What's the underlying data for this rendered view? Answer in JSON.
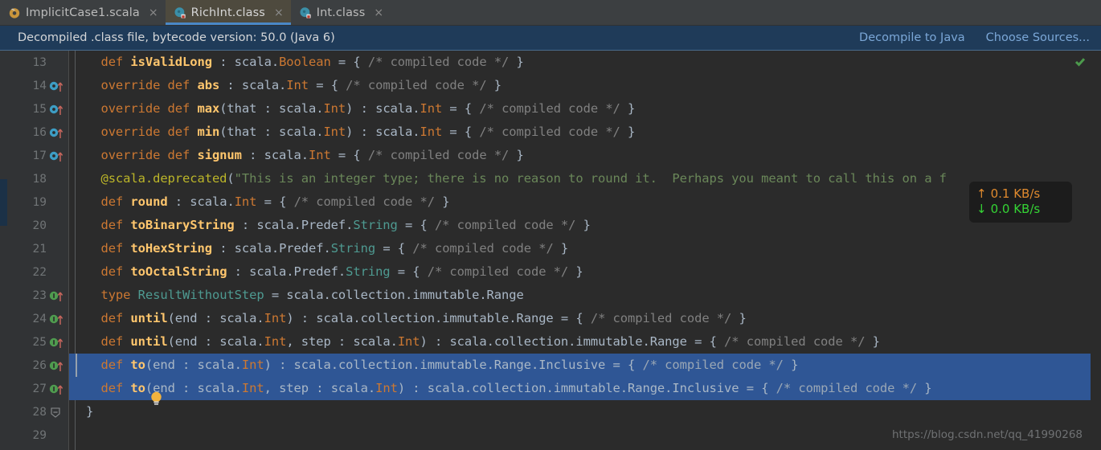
{
  "tabs": [
    {
      "label": "ImplicitCase1.scala",
      "icon": "scala-file-icon",
      "active": false,
      "close": "×"
    },
    {
      "label": "RichInt.class",
      "icon": "class-file-icon",
      "active": true,
      "close": "×"
    },
    {
      "label": "Int.class",
      "icon": "class-file-icon",
      "active": false,
      "close": "×"
    }
  ],
  "banner": {
    "message": "Decompiled .class file, bytecode version: 50.0 (Java 6)",
    "decompile_label": "Decompile to Java",
    "choose_sources_label": "Choose Sources...",
    "background": "#1f3b59",
    "link_color": "#7ba7d7"
  },
  "network_widget": {
    "up_arrow": "↑",
    "up_value": "0.1 KB/s",
    "up_color": "#e08a2e",
    "down_arrow": "↓",
    "down_value": "0.0 KB/s",
    "down_color": "#35d435"
  },
  "watermark": "https://blog.csdn.net/qq_41990268",
  "editor": {
    "first_visible_line": 13,
    "selected_lines": [
      26,
      27
    ],
    "selection_color": "#2f5695",
    "background": "#2b2b2b",
    "gutter_background": "#313335",
    "lines": [
      {
        "number": 13,
        "marker": "none",
        "text": "def isValidLong : scala.Boolean = { /* compiled code */ }",
        "tokens": [
          {
            "t": "  ",
            "c": "pn"
          },
          {
            "t": "def ",
            "c": "k"
          },
          {
            "t": "isValidLong",
            "c": "mn"
          },
          {
            "t": " : ",
            "c": "pn"
          },
          {
            "t": "scala.",
            "c": "pk"
          },
          {
            "t": "Boolean",
            "c": "ty"
          },
          {
            "t": " = { ",
            "c": "pn"
          },
          {
            "t": "/* compiled code */",
            "c": "cm"
          },
          {
            "t": " }",
            "c": "pn"
          }
        ]
      },
      {
        "number": 14,
        "marker": "override",
        "text": "override def abs : scala.Int = { /* compiled code */ }",
        "tokens": [
          {
            "t": "  ",
            "c": "pn"
          },
          {
            "t": "override def ",
            "c": "k"
          },
          {
            "t": "abs",
            "c": "mn"
          },
          {
            "t": " : ",
            "c": "pn"
          },
          {
            "t": "scala.",
            "c": "pk"
          },
          {
            "t": "Int",
            "c": "ty"
          },
          {
            "t": " = { ",
            "c": "pn"
          },
          {
            "t": "/* compiled code */",
            "c": "cm"
          },
          {
            "t": " }",
            "c": "pn"
          }
        ]
      },
      {
        "number": 15,
        "marker": "override",
        "text": "override def max(that : scala.Int) : scala.Int = { /* compiled code */ }",
        "tokens": [
          {
            "t": "  ",
            "c": "pn"
          },
          {
            "t": "override def ",
            "c": "k"
          },
          {
            "t": "max",
            "c": "mn"
          },
          {
            "t": "(that : ",
            "c": "pn"
          },
          {
            "t": "scala.",
            "c": "pk"
          },
          {
            "t": "Int",
            "c": "ty"
          },
          {
            "t": ") : ",
            "c": "pn"
          },
          {
            "t": "scala.",
            "c": "pk"
          },
          {
            "t": "Int",
            "c": "ty"
          },
          {
            "t": " = { ",
            "c": "pn"
          },
          {
            "t": "/* compiled code */",
            "c": "cm"
          },
          {
            "t": " }",
            "c": "pn"
          }
        ]
      },
      {
        "number": 16,
        "marker": "override",
        "text": "override def min(that : scala.Int) : scala.Int = { /* compiled code */ }",
        "tokens": [
          {
            "t": "  ",
            "c": "pn"
          },
          {
            "t": "override def ",
            "c": "k"
          },
          {
            "t": "min",
            "c": "mn"
          },
          {
            "t": "(that : ",
            "c": "pn"
          },
          {
            "t": "scala.",
            "c": "pk"
          },
          {
            "t": "Int",
            "c": "ty"
          },
          {
            "t": ") : ",
            "c": "pn"
          },
          {
            "t": "scala.",
            "c": "pk"
          },
          {
            "t": "Int",
            "c": "ty"
          },
          {
            "t": " = { ",
            "c": "pn"
          },
          {
            "t": "/* compiled code */",
            "c": "cm"
          },
          {
            "t": " }",
            "c": "pn"
          }
        ]
      },
      {
        "number": 17,
        "marker": "override",
        "text": "override def signum : scala.Int = { /* compiled code */ }",
        "tokens": [
          {
            "t": "  ",
            "c": "pn"
          },
          {
            "t": "override def ",
            "c": "k"
          },
          {
            "t": "signum",
            "c": "mn"
          },
          {
            "t": " : ",
            "c": "pn"
          },
          {
            "t": "scala.",
            "c": "pk"
          },
          {
            "t": "Int",
            "c": "ty"
          },
          {
            "t": " = { ",
            "c": "pn"
          },
          {
            "t": "/* compiled code */",
            "c": "cm"
          },
          {
            "t": " }",
            "c": "pn"
          }
        ]
      },
      {
        "number": 18,
        "marker": "none",
        "text": "@scala.deprecated(\"This is an integer type; there is no reason to round it.  Perhaps you meant to call this on a f",
        "tokens": [
          {
            "t": "  ",
            "c": "pn"
          },
          {
            "t": "@scala.deprecated",
            "c": "an"
          },
          {
            "t": "(",
            "c": "pn"
          },
          {
            "t": "\"This is an integer type; there is no reason to round it.  Perhaps you meant to call this on a f",
            "c": "st"
          }
        ]
      },
      {
        "number": 19,
        "marker": "none",
        "text": "def round : scala.Int = { /* compiled code */ }",
        "tokens": [
          {
            "t": "  ",
            "c": "pn"
          },
          {
            "t": "def ",
            "c": "k"
          },
          {
            "t": "round",
            "c": "mn"
          },
          {
            "t": " : ",
            "c": "pn"
          },
          {
            "t": "scala.",
            "c": "pk"
          },
          {
            "t": "Int",
            "c": "ty"
          },
          {
            "t": " = { ",
            "c": "pn"
          },
          {
            "t": "/* compiled code */",
            "c": "cm"
          },
          {
            "t": " }",
            "c": "pn"
          }
        ]
      },
      {
        "number": 20,
        "marker": "none",
        "text": "def toBinaryString : scala.Predef.String = { /* compiled code */ }",
        "tokens": [
          {
            "t": "  ",
            "c": "pn"
          },
          {
            "t": "def ",
            "c": "k"
          },
          {
            "t": "toBinaryString",
            "c": "mn"
          },
          {
            "t": " : ",
            "c": "pn"
          },
          {
            "t": "scala.Predef.",
            "c": "pk"
          },
          {
            "t": "String",
            "c": "ty2"
          },
          {
            "t": " = { ",
            "c": "pn"
          },
          {
            "t": "/* compiled code */",
            "c": "cm"
          },
          {
            "t": " }",
            "c": "pn"
          }
        ]
      },
      {
        "number": 21,
        "marker": "none",
        "text": "def toHexString : scala.Predef.String = { /* compiled code */ }",
        "tokens": [
          {
            "t": "  ",
            "c": "pn"
          },
          {
            "t": "def ",
            "c": "k"
          },
          {
            "t": "toHexString",
            "c": "mn"
          },
          {
            "t": " : ",
            "c": "pn"
          },
          {
            "t": "scala.Predef.",
            "c": "pk"
          },
          {
            "t": "String",
            "c": "ty2"
          },
          {
            "t": " = { ",
            "c": "pn"
          },
          {
            "t": "/* compiled code */",
            "c": "cm"
          },
          {
            "t": " }",
            "c": "pn"
          }
        ]
      },
      {
        "number": 22,
        "marker": "none",
        "text": "def toOctalString : scala.Predef.String = { /* compiled code */ }",
        "tokens": [
          {
            "t": "  ",
            "c": "pn"
          },
          {
            "t": "def ",
            "c": "k"
          },
          {
            "t": "toOctalString",
            "c": "mn"
          },
          {
            "t": " : ",
            "c": "pn"
          },
          {
            "t": "scala.Predef.",
            "c": "pk"
          },
          {
            "t": "String",
            "c": "ty2"
          },
          {
            "t": " = { ",
            "c": "pn"
          },
          {
            "t": "/* compiled code */",
            "c": "cm"
          },
          {
            "t": " }",
            "c": "pn"
          }
        ]
      },
      {
        "number": 23,
        "marker": "implement",
        "text": "type ResultWithoutStep = scala.collection.immutable.Range",
        "tokens": [
          {
            "t": "  ",
            "c": "pn"
          },
          {
            "t": "type ",
            "c": "k"
          },
          {
            "t": "ResultWithoutStep",
            "c": "ty2"
          },
          {
            "t": " = ",
            "c": "pn"
          },
          {
            "t": "scala.collection.immutable.Range",
            "c": "pk"
          }
        ]
      },
      {
        "number": 24,
        "marker": "implement",
        "text": "def until(end : scala.Int) : scala.collection.immutable.Range = { /* compiled code */ }",
        "tokens": [
          {
            "t": "  ",
            "c": "pn"
          },
          {
            "t": "def ",
            "c": "k"
          },
          {
            "t": "until",
            "c": "mn"
          },
          {
            "t": "(end : ",
            "c": "pn"
          },
          {
            "t": "scala.",
            "c": "pk"
          },
          {
            "t": "Int",
            "c": "ty"
          },
          {
            "t": ") : ",
            "c": "pn"
          },
          {
            "t": "scala.collection.immutable.Range",
            "c": "pk"
          },
          {
            "t": " = { ",
            "c": "pn"
          },
          {
            "t": "/* compiled code */",
            "c": "cm"
          },
          {
            "t": " }",
            "c": "pn"
          }
        ]
      },
      {
        "number": 25,
        "marker": "implement",
        "text": "def until(end : scala.Int, step : scala.Int) : scala.collection.immutable.Range = { /* compiled code */ }",
        "tokens": [
          {
            "t": "  ",
            "c": "pn"
          },
          {
            "t": "def ",
            "c": "k"
          },
          {
            "t": "until",
            "c": "mn"
          },
          {
            "t": "(end : ",
            "c": "pn"
          },
          {
            "t": "scala.",
            "c": "pk"
          },
          {
            "t": "Int",
            "c": "ty"
          },
          {
            "t": ", step : ",
            "c": "pn"
          },
          {
            "t": "scala.",
            "c": "pk"
          },
          {
            "t": "Int",
            "c": "ty"
          },
          {
            "t": ") : ",
            "c": "pn"
          },
          {
            "t": "scala.collection.immutable.Range",
            "c": "pk"
          },
          {
            "t": " = { ",
            "c": "pn"
          },
          {
            "t": "/* compiled code */",
            "c": "cm"
          },
          {
            "t": " }",
            "c": "pn"
          }
        ]
      },
      {
        "number": 26,
        "marker": "implement",
        "text": "def to(end : scala.Int) : scala.collection.immutable.Range.Inclusive = { /* compiled code */ }",
        "tokens": [
          {
            "t": "  ",
            "c": "pn"
          },
          {
            "t": "def ",
            "c": "k"
          },
          {
            "t": "to",
            "c": "mn"
          },
          {
            "t": "(end : ",
            "c": "pn"
          },
          {
            "t": "scala.",
            "c": "pk"
          },
          {
            "t": "Int",
            "c": "ty"
          },
          {
            "t": ") : ",
            "c": "pn"
          },
          {
            "t": "scala.collection.immutable.Range.Inclusive",
            "c": "pk"
          },
          {
            "t": " = { ",
            "c": "pn"
          },
          {
            "t": "/* compiled code */",
            "c": "cm"
          },
          {
            "t": " }",
            "c": "pn"
          }
        ]
      },
      {
        "number": 27,
        "marker": "implement",
        "text": "def to(end : scala.Int, step : scala.Int) : scala.collection.immutable.Range.Inclusive = { /* compiled code */ }",
        "tokens": [
          {
            "t": "  ",
            "c": "pn"
          },
          {
            "t": "def ",
            "c": "k"
          },
          {
            "t": "to",
            "c": "mn"
          },
          {
            "t": "(end : ",
            "c": "pn"
          },
          {
            "t": "scala.",
            "c": "pk"
          },
          {
            "t": "Int",
            "c": "ty"
          },
          {
            "t": ", step : ",
            "c": "pn"
          },
          {
            "t": "scala.",
            "c": "pk"
          },
          {
            "t": "Int",
            "c": "ty"
          },
          {
            "t": ") : ",
            "c": "pn"
          },
          {
            "t": "scala.collection.immutable.Range.Inclusive",
            "c": "pk"
          },
          {
            "t": " = { ",
            "c": "pn"
          },
          {
            "t": "/* compiled code */",
            "c": "cm"
          },
          {
            "t": " }",
            "c": "pn"
          }
        ]
      },
      {
        "number": 28,
        "marker": "fold",
        "text": "}",
        "tokens": [
          {
            "t": "}",
            "c": "pn"
          }
        ]
      },
      {
        "number": 29,
        "marker": "none",
        "text": "",
        "tokens": []
      }
    ]
  }
}
